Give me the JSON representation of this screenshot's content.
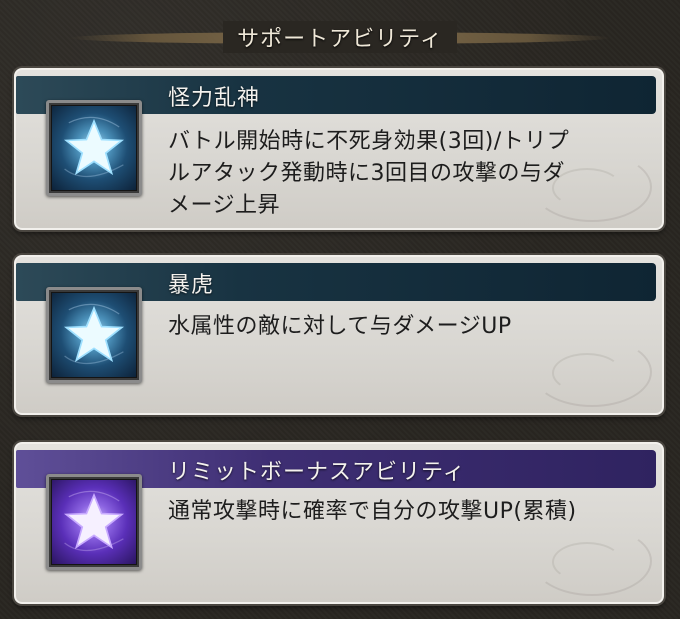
{
  "header": {
    "title": "サポートアビリティ"
  },
  "abilities": [
    {
      "name": "怪力乱神",
      "lines": [
        "バトル開始時に不死身効果(3回)/トリプ",
        "ルアタック発動時に3回目の攻撃の与ダ",
        "メージ上昇"
      ],
      "icon": "star-icon",
      "theme": "#183342"
    },
    {
      "name": "暴虎",
      "lines": [
        "水属性の敵に対して与ダメージUP"
      ],
      "icon": "star-icon",
      "theme": "#183342"
    },
    {
      "name": "リミットボーナスアビリティ",
      "lines": [
        "通常攻撃時に確率で自分の攻撃UP(累積)"
      ],
      "icon": "star-icon",
      "theme": "#3e2e73"
    }
  ]
}
